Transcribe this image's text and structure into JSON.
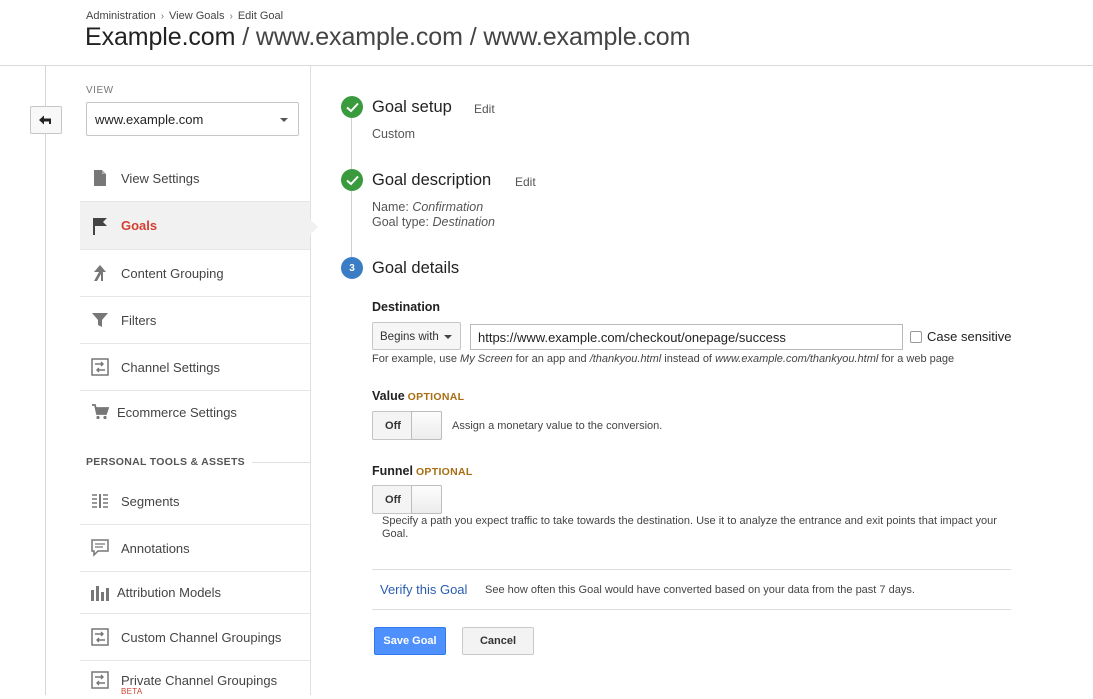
{
  "breadcrumb": [
    "Administration",
    "View Goals",
    "Edit Goal"
  ],
  "breadcrumb_sep": "›",
  "title": {
    "account": "Example.com",
    "sep": "/",
    "property": "www.example.com",
    "view": "www.example.com"
  },
  "sidebar": {
    "view_label": "VIEW",
    "view_selected": "www.example.com",
    "items": [
      {
        "label": "View Settings",
        "icon": "document-icon"
      },
      {
        "label": "Goals",
        "icon": "flag-icon",
        "active": true
      },
      {
        "label": "Content Grouping",
        "icon": "content-grouping-icon"
      },
      {
        "label": "Filters",
        "icon": "filter-icon"
      },
      {
        "label": "Channel Settings",
        "icon": "channel-settings-icon"
      },
      {
        "label": "Ecommerce Settings",
        "icon": "cart-icon"
      }
    ],
    "section_title": "PERSONAL TOOLS & ASSETS",
    "tools": [
      {
        "label": "Segments",
        "icon": "segments-icon"
      },
      {
        "label": "Annotations",
        "icon": "annotation-icon"
      },
      {
        "label": "Attribution Models",
        "icon": "bar-chart-icon"
      },
      {
        "label": "Custom Channel Groupings",
        "icon": "channel-grouping-icon"
      },
      {
        "label": "Private Channel Groupings",
        "icon": "channel-grouping-icon",
        "badge": "BETA"
      }
    ]
  },
  "steps": {
    "setup": {
      "title": "Goal setup",
      "edit": "Edit",
      "value": "Custom"
    },
    "description": {
      "title": "Goal description",
      "edit": "Edit",
      "name_label": "Name:",
      "name_value": "Confirmation",
      "type_label": "Goal type:",
      "type_value": "Destination"
    },
    "details": {
      "number": "3",
      "title": "Goal details"
    }
  },
  "destination": {
    "label": "Destination",
    "match_type": "Begins with",
    "url": "https://www.example.com/checkout/onepage/success",
    "case_sensitive_label": "Case sensitive",
    "case_sensitive": false,
    "hint": {
      "p1": "For example, use ",
      "app_example": "My Screen",
      "p2": " for an app and ",
      "path_example": "/thankyou.html",
      "p3": " instead of ",
      "url_example": "www.example.com/thankyou.html",
      "p4": " for a web page"
    }
  },
  "value": {
    "label": "Value",
    "optional": "OPTIONAL",
    "toggle": "Off",
    "desc": "Assign a monetary value to the conversion."
  },
  "funnel": {
    "label": "Funnel",
    "optional": "OPTIONAL",
    "toggle": "Off",
    "desc_line1": "Specify a path you expect traffic to take towards the destination. Use it to analyze the entrance and exit points that impact your",
    "desc_line2": "Goal."
  },
  "verify": {
    "link": "Verify this Goal",
    "desc": "See how often this Goal would have converted based on your data from the past 7 days."
  },
  "buttons": {
    "save": "Save Goal",
    "cancel": "Cancel"
  },
  "colors": {
    "accent": "#4d90fe",
    "active_nav": "#d23f31",
    "done": "#3a9b3e",
    "current_step": "#3b7dc4",
    "optional": "#a86d13",
    "link": "#2a5db0"
  }
}
